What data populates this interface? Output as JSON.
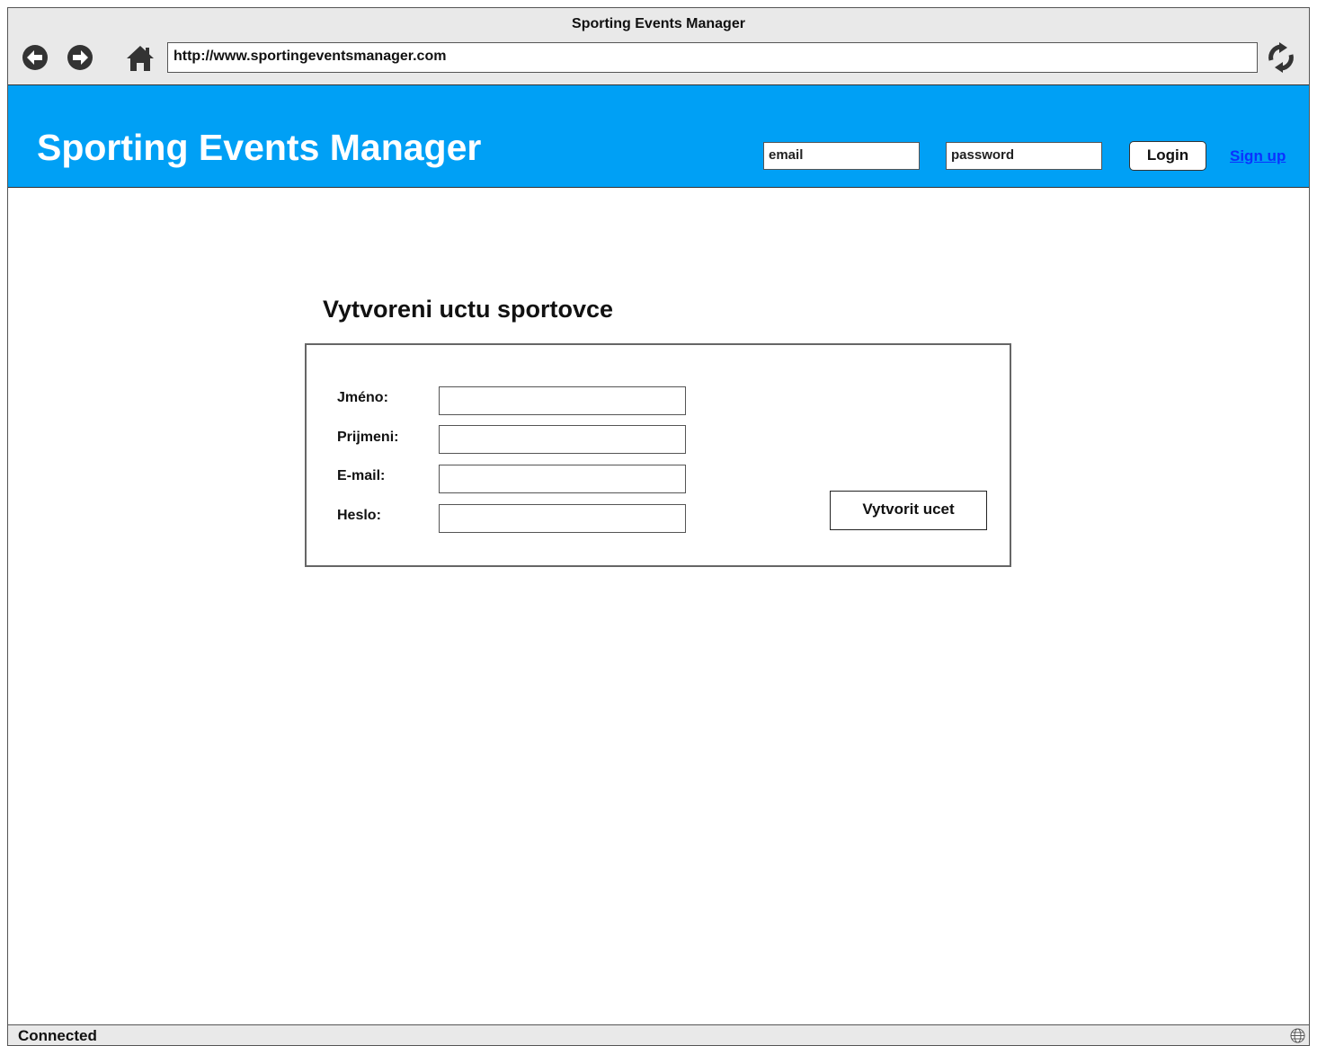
{
  "window": {
    "title": "Sporting Events Manager"
  },
  "browser": {
    "url": "http://www.sportingeventsmanager.com"
  },
  "header": {
    "brand": "Sporting Events Manager",
    "email_placeholder": "email",
    "password_placeholder": "password",
    "login_label": "Login",
    "signup_label": "Sign up"
  },
  "page": {
    "heading": "Vytvoreni uctu sportovce",
    "fields": [
      {
        "label": "Jméno:"
      },
      {
        "label": "Prijmeni:"
      },
      {
        "label": "E-mail:"
      },
      {
        "label": "Heslo:"
      }
    ],
    "submit_label": "Vytvorit ucet"
  },
  "status": {
    "text": "Connected"
  },
  "colors": {
    "header_bg": "#00a0f5",
    "link": "#0a32ff",
    "chrome": "#e9e9e9"
  }
}
